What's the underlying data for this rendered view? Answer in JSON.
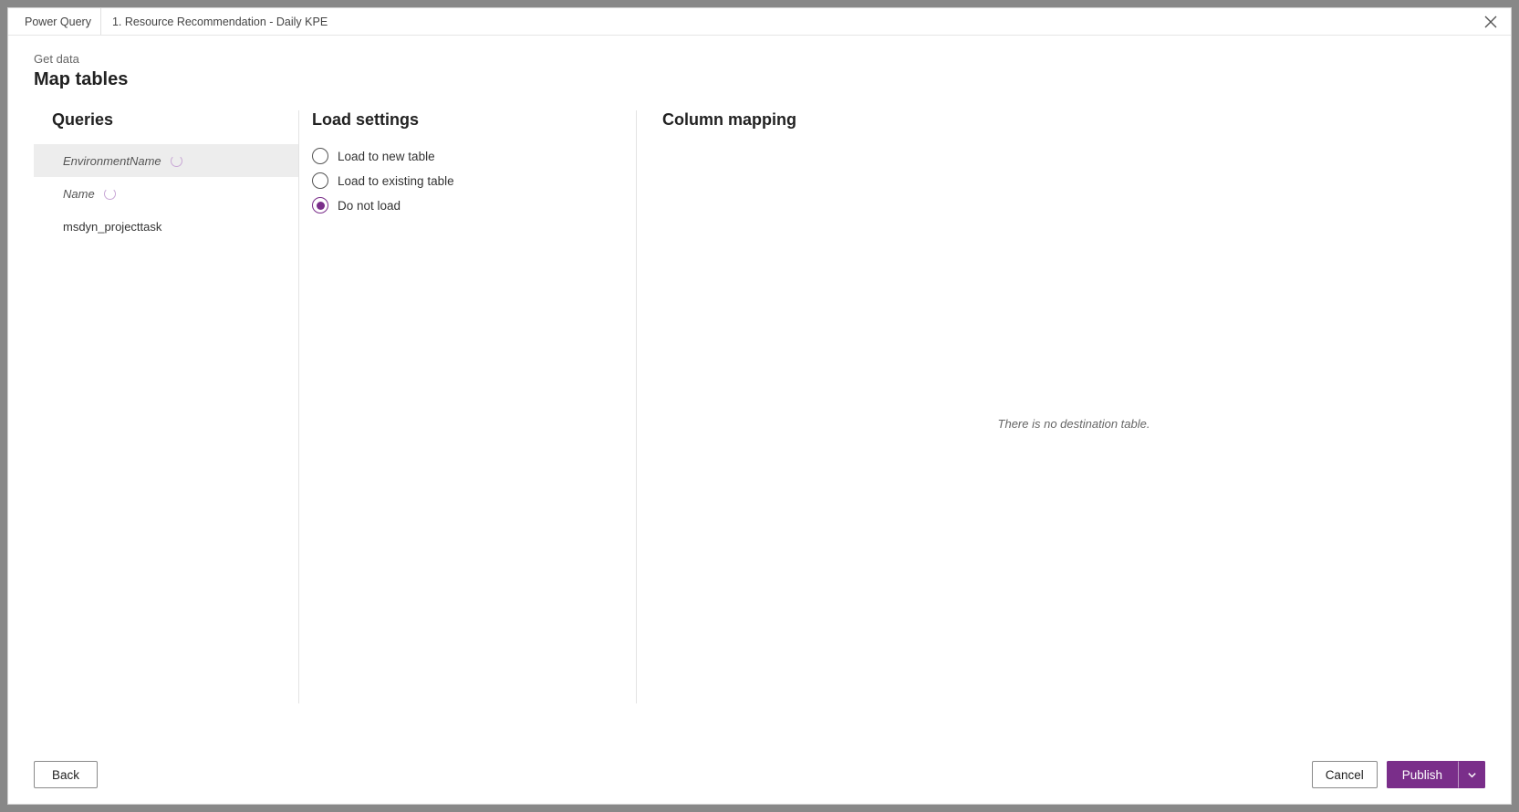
{
  "titlebar": {
    "app": "Power Query",
    "doc": "1. Resource Recommendation - Daily KPE"
  },
  "breadcrumb": "Get data",
  "page_title": "Map tables",
  "queries": {
    "heading": "Queries",
    "items": [
      {
        "label": "EnvironmentName",
        "selected": true,
        "loading": true,
        "italic": true
      },
      {
        "label": "Name",
        "selected": false,
        "loading": true,
        "italic": true
      },
      {
        "label": "msdyn_projecttask",
        "selected": false,
        "loading": false,
        "italic": false
      }
    ]
  },
  "load_settings": {
    "heading": "Load settings",
    "options": [
      {
        "label": "Load to new table",
        "selected": false
      },
      {
        "label": "Load to existing table",
        "selected": false
      },
      {
        "label": "Do not load",
        "selected": true
      }
    ]
  },
  "column_mapping": {
    "heading": "Column mapping",
    "placeholder": "There is no destination table."
  },
  "footer": {
    "back": "Back",
    "cancel": "Cancel",
    "publish": "Publish"
  }
}
